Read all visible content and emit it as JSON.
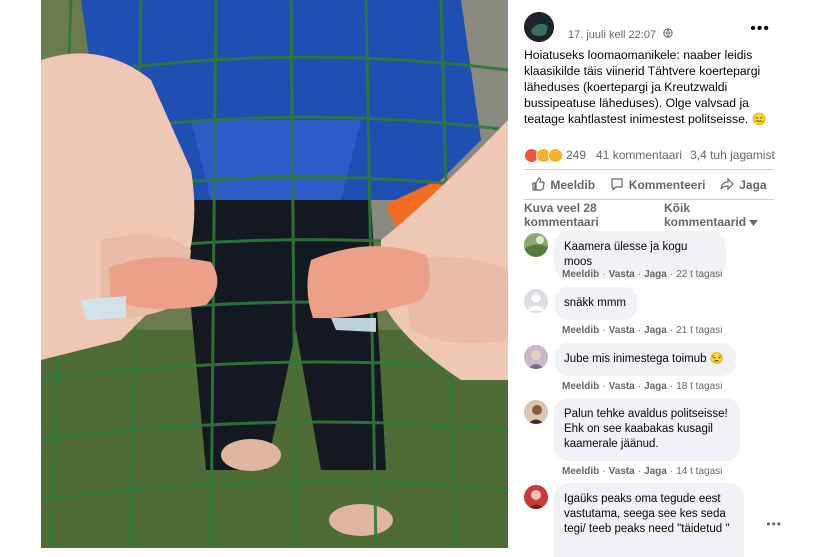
{
  "post": {
    "timestamp": "17. juuli kell 22:07",
    "privacy_icon": "globe-icon",
    "menu_icon": "more-horizontal-icon",
    "text": "Hoiatuseks loomaomanikele: naaber leidis klaasikilde täis viinerid Tähtvere koertepargi läheduses (koertepargi ja Kreutzwaldi bussipeatuse läheduses). Olge valvsad ja teatage kahtlastest inimestest politseisse. 😑"
  },
  "reactions": {
    "count": "249",
    "comments": "41 kommentaari",
    "shares": "3,4 tuh jagamist",
    "colors": {
      "angry": "#f5533d",
      "sad": "#f7b125",
      "wow": "#f7b125"
    }
  },
  "actions": {
    "like": "Meeldib",
    "comment": "Kommenteeri",
    "share": "Jaga"
  },
  "comments_bar": {
    "view_more": "Kuva veel 28 kommentaari",
    "sort": "Kõik kommentaarid"
  },
  "comments": [
    {
      "text": "Kaamera ülesse ja kogu moos",
      "like": "Meeldib",
      "reply": "Vasta",
      "share": "Jaga",
      "time": "22 t tagasi"
    },
    {
      "text": "snäkk mmm",
      "like": "Meeldib",
      "reply": "Vasta",
      "share": "Jaga",
      "time": "21 t tagasi"
    },
    {
      "text": "Jube mis inimestega toimub 😒",
      "like": "Meeldib",
      "reply": "Vasta",
      "share": "Jaga",
      "time": "18 t tagasi"
    },
    {
      "text": "Palun tehke avaldus politseisse! Ehk on see kaabakas kusagil kaamerale jäänud.",
      "like": "Meeldib",
      "reply": "Vasta",
      "share": "Jaga",
      "time": "14 t tagasi"
    },
    {
      "text": "Igaüks peaks oma tegude eest vastutama, seega see kes seda tegi/ teeb peaks need \"täidetud \"",
      "like": "",
      "reply": "",
      "share": "",
      "time": ""
    }
  ]
}
